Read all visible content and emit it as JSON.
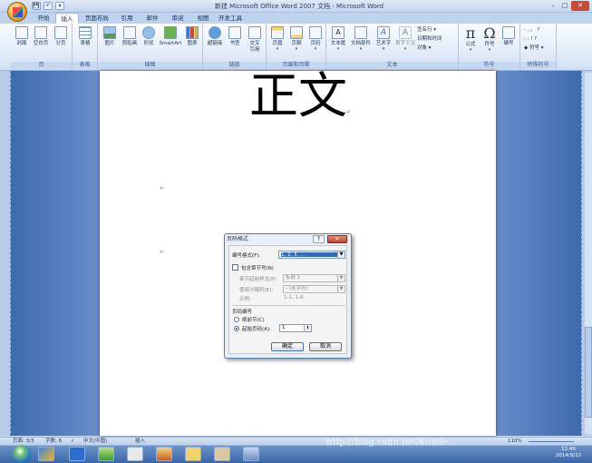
{
  "window": {
    "title": "新建 Microsoft Office Word 2007 文档 - Microsoft Word",
    "controls": {
      "minimize": "–",
      "maximize": "□",
      "close": "✕"
    }
  },
  "quick_access": [
    "💾",
    "↶",
    "▾"
  ],
  "ribbon": {
    "tabs": [
      "开始",
      "插入",
      "页面布局",
      "引用",
      "邮件",
      "审阅",
      "视图",
      "开发工具"
    ],
    "active_tab": "插入",
    "groups": [
      {
        "label": "页",
        "buttons": [
          "封面",
          "空白页",
          "分页"
        ]
      },
      {
        "label": "表格",
        "buttons": [
          "表格"
        ]
      },
      {
        "label": "插图",
        "buttons": [
          "图片",
          "剪贴画",
          "形状",
          "SmartArt",
          "图表"
        ]
      },
      {
        "label": "链接",
        "buttons": [
          "超链接",
          "书签",
          "交叉引用"
        ]
      },
      {
        "label": "页眉和页脚",
        "buttons": [
          "页眉",
          "页脚",
          "页码"
        ]
      },
      {
        "label": "文本",
        "buttons": [
          "文本框",
          "文档部件",
          "艺术字",
          "首字下沉"
        ],
        "small": [
          "签名行 ▾",
          "日期和时间",
          "对象 ▾"
        ]
      },
      {
        "label": "符号",
        "buttons": [
          "公式",
          "符号",
          "编号"
        ]
      },
      {
        "label": "特殊符号",
        "small": [
          "· , 。 ?",
          "; : ! ?",
          "◆ 符号 ▾"
        ]
      }
    ]
  },
  "document": {
    "heading": "正文",
    "para_marks": [
      "↵",
      "↵",
      "↵"
    ]
  },
  "dialog": {
    "title": "页码格式",
    "help": "?",
    "close": "✕",
    "number_format_label": "编号格式(F):",
    "number_format_value": "1, 2, 3, ...",
    "include_chapter_label": "包含章节号(N)",
    "chapter_style_label": "章节起始样式(P)",
    "chapter_style_value": "标题 1",
    "separator_label": "使用分隔符(E):",
    "separator_value": "- (连字符)",
    "example_label": "示例:",
    "example_value": "1-1, 1-A",
    "numbering_section": "页码编号",
    "continue_label": "续前节(C)",
    "start_at_label": "起始页码(A):",
    "start_at_value": "1",
    "ok": "确定",
    "cancel": "取消"
  },
  "statusbar": {
    "page": "页面: 3/3",
    "words": "字数: 6",
    "language": "中文(中国)",
    "mode": "插入",
    "zoom": "110%"
  },
  "watermark": "http://blog.csdn.net/kuaile...",
  "clock": {
    "time": "12:49",
    "date": "2014/9/22"
  }
}
